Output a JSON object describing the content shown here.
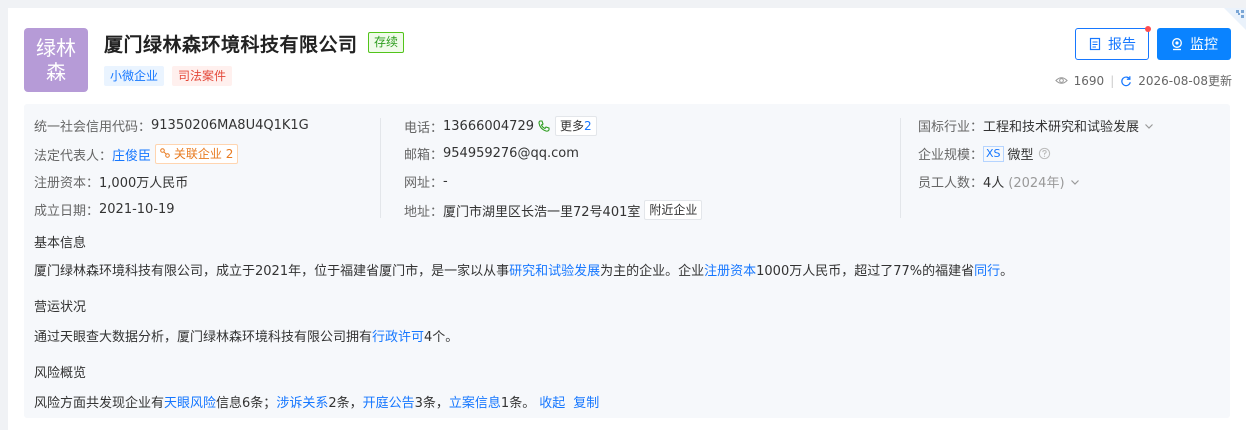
{
  "company": {
    "logo_text": "绿林森",
    "name": "厦门绿林森环境科技有限公司",
    "status": "存续",
    "tags": [
      "小微企业",
      "司法案件"
    ]
  },
  "actions": {
    "report_label": "报告",
    "monitor_label": "监控"
  },
  "meta": {
    "views": "1690",
    "updated": "2026-08-08更新"
  },
  "basic": {
    "credit_code_label": "统一社会信用代码：",
    "credit_code": "91350206MA8U4Q1K1G",
    "legal_rep_label": "法定代表人：",
    "legal_rep": "庄俊臣",
    "related_label": "关联企业",
    "related_count": "2",
    "capital_label": "注册资本：",
    "capital": "1,000万人民币",
    "founded_label": "成立日期：",
    "founded": "2021-10-19",
    "phone_label": "电话：",
    "phone": "13666004729",
    "more_label": "更多",
    "more_count": "2",
    "email_label": "邮箱：",
    "email": "954959276@qq.com",
    "website_label": "网址：",
    "website": "-",
    "address_label": "地址：",
    "address": "厦门市湖里区长浩一里72号401室",
    "nearby_label": "附近企业",
    "industry_label": "国标行业：",
    "industry": "工程和技术研究和试验发展",
    "scale_label": "企业规模：",
    "scale_badge": "XS",
    "scale": "微型",
    "staff_label": "员工人数：",
    "staff": "4人",
    "staff_year": "(2024年)"
  },
  "sections": {
    "basic_title": "基本信息",
    "basic_text_1": "厦门绿林森环境科技有限公司，成立于2021年，位于福建省厦门市，是一家以从事",
    "basic_link_1": "研究和试验发展",
    "basic_text_2": "为主的企业。企业",
    "basic_link_2": "注册资本",
    "basic_text_3": "1000万人民币，超过了77%的福建省",
    "basic_link_3": "同行",
    "basic_text_4": "。",
    "ops_title": "营运状况",
    "ops_text_1": "通过天眼查大数据分析，厦门绿林森环境科技有限公司拥有",
    "ops_link": "行政许可",
    "ops_text_2": "4个。",
    "risk_title": "风险概览",
    "risk_text_1": "风险方面共发现企业有",
    "risk_link_1": "天眼风险",
    "risk_text_2": "信息6条；",
    "risk_link_2": "涉诉关系",
    "risk_text_3": "2条，",
    "risk_link_3": "开庭公告",
    "risk_text_4": "3条，",
    "risk_link_4": "立案信息",
    "risk_text_5": "1条。",
    "collapse_label": "收起",
    "copy_label": "复制"
  }
}
